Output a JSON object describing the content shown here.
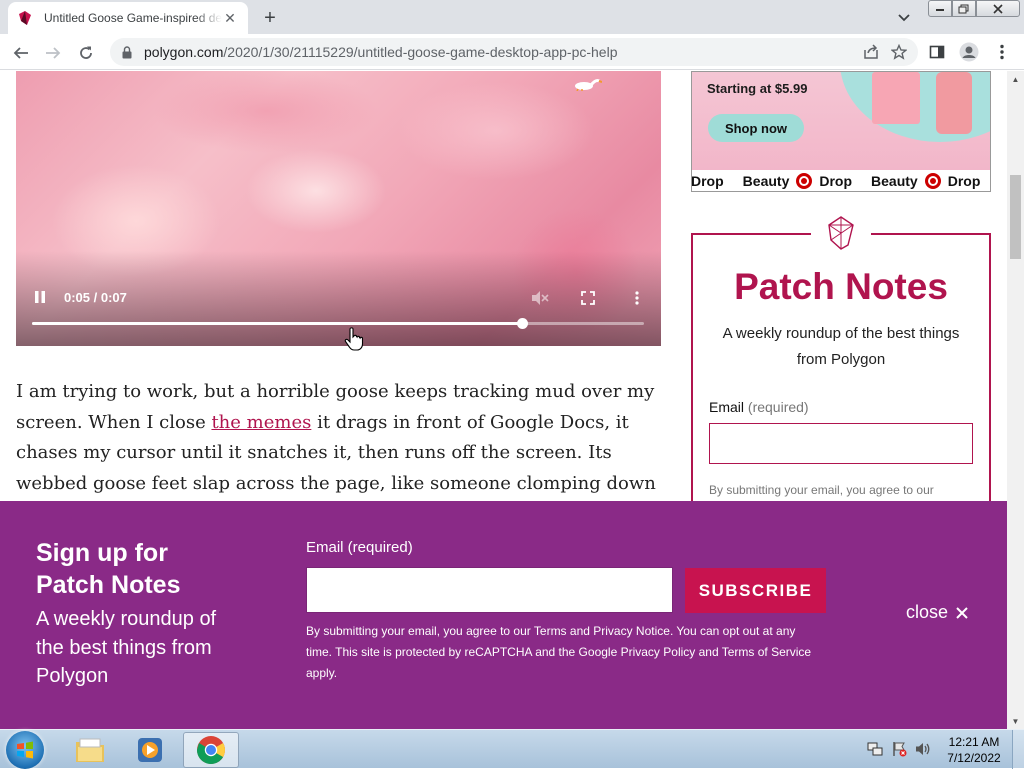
{
  "browser": {
    "tab_title": "Untitled Goose Game-inspired desktop app",
    "url_host": "polygon.com",
    "url_path": "/2020/1/30/21115229/untitled-goose-game-desktop-app-pc-help"
  },
  "video": {
    "time": "0:05 / 0:07",
    "progress_fraction": 0.8
  },
  "article": {
    "text_before_link": "I am trying to work, but a horrible goose keeps tracking mud over my screen. When I close ",
    "link": "the memes",
    "text_after_link": " it drags in front of Google Docs, it chases my cursor until it snatches it, then runs off the screen. Its webbed goose feet slap across the page, like someone clomping down a hallway in flip-flops. Intermittent"
  },
  "ad": {
    "price": "Starting at $5.99",
    "cta": "Shop now",
    "ticker": [
      "Drop",
      "Beauty",
      "Drop",
      "Beauty",
      "Drop"
    ]
  },
  "sidebar_newsletter": {
    "title": "Patch Notes",
    "subtitle": "A weekly roundup of the best things from Polygon",
    "email_label": "Email",
    "email_required": "(required)",
    "fine_print": "By submitting your email, you agree to our"
  },
  "signup_bar": {
    "title_line1": "Sign up for",
    "title_line2": "Patch Notes",
    "subtitle": "A weekly roundup of the best things from Polygon",
    "email_label": "Email (required)",
    "subscribe": "SUBSCRIBE",
    "fine_print": "By submitting your email, you agree to our Terms and Privacy Notice. You can opt out at any time. This site is protected by reCAPTCHA and the Google Privacy Policy and Terms of Service apply.",
    "close": "close"
  },
  "taskbar": {
    "time": "12:21 AM",
    "date": "7/12/2022"
  },
  "colors": {
    "brand_pink": "#b0144e",
    "signup_purple": "#8a2a87",
    "subscribe_red": "#c8134f"
  }
}
